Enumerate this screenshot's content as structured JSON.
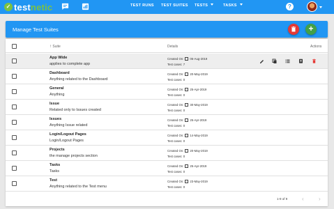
{
  "app": {
    "logo_part1": "test",
    "logo_part2": "netic"
  },
  "nav": {
    "items": [
      {
        "label": "TEST RUNS"
      },
      {
        "label": "TEST SUITES"
      },
      {
        "label": "TESTS"
      },
      {
        "label": "TASKS"
      }
    ],
    "help_glyph": "?"
  },
  "header": {
    "title": "Manage Test Suites",
    "add_glyph": "+"
  },
  "table": {
    "col_suite": "Suite",
    "col_details": "Details",
    "col_actions": "Actions",
    "rows": [
      {
        "name": "App Wide",
        "description": "applies to complete app",
        "created_label": "Created On:",
        "created": "06-Aug-2019",
        "cases_label": "Test cases:",
        "cases": "7"
      },
      {
        "name": "Dashboard",
        "description": "Anything related to the Dashboard",
        "created_label": "Created On:",
        "created": "20-May-2019",
        "cases_label": "Test cases:",
        "cases": "0"
      },
      {
        "name": "General",
        "description": "Anything",
        "created_label": "Created On:",
        "created": "25-Apr-2019",
        "cases_label": "Test cases:",
        "cases": "0"
      },
      {
        "name": "Issue",
        "description": "Related only to Issues created",
        "created_label": "Created On:",
        "created": "30-May-2019",
        "cases_label": "Test cases:",
        "cases": "0"
      },
      {
        "name": "Issues",
        "description": "Anything Issue related",
        "created_label": "Created On:",
        "created": "25-Apr-2019",
        "cases_label": "Test cases:",
        "cases": "0"
      },
      {
        "name": "Login/Logout Pages",
        "description": "Login/Logout Pages",
        "created_label": "Created On:",
        "created": "14-May-2019",
        "cases_label": "Test cases:",
        "cases": "0"
      },
      {
        "name": "Projects",
        "description": "the manage projects section",
        "created_label": "Created On:",
        "created": "20-May-2019",
        "cases_label": "Test cases:",
        "cases": "0"
      },
      {
        "name": "Tasks",
        "description": "Tasks",
        "created_label": "Created On:",
        "created": "25-Apr-2019",
        "cases_label": "Test cases:",
        "cases": "0"
      },
      {
        "name": "Test",
        "description": "Anything related to the Test menu",
        "created_label": "Created On:",
        "created": "23-May-2019",
        "cases_label": "Test cases:",
        "cases": "0"
      }
    ]
  },
  "pagination": {
    "range": "1-9 of 9",
    "prev_glyph": "‹",
    "next_glyph": "›"
  },
  "icons": {
    "logo": "check-circle-icon",
    "chat": "chat-icon",
    "report": "report-icon",
    "help": "help-icon",
    "sort": "arrow-up-icon",
    "calendar": "calendar-icon",
    "row_actions": [
      "edit-icon",
      "copy-icon",
      "list-icon",
      "archive-icon",
      "delete-icon"
    ]
  },
  "colors": {
    "primary": "#2196f3",
    "logo_green": "#7cc242",
    "danger": "#e53935",
    "success": "#43a047"
  }
}
